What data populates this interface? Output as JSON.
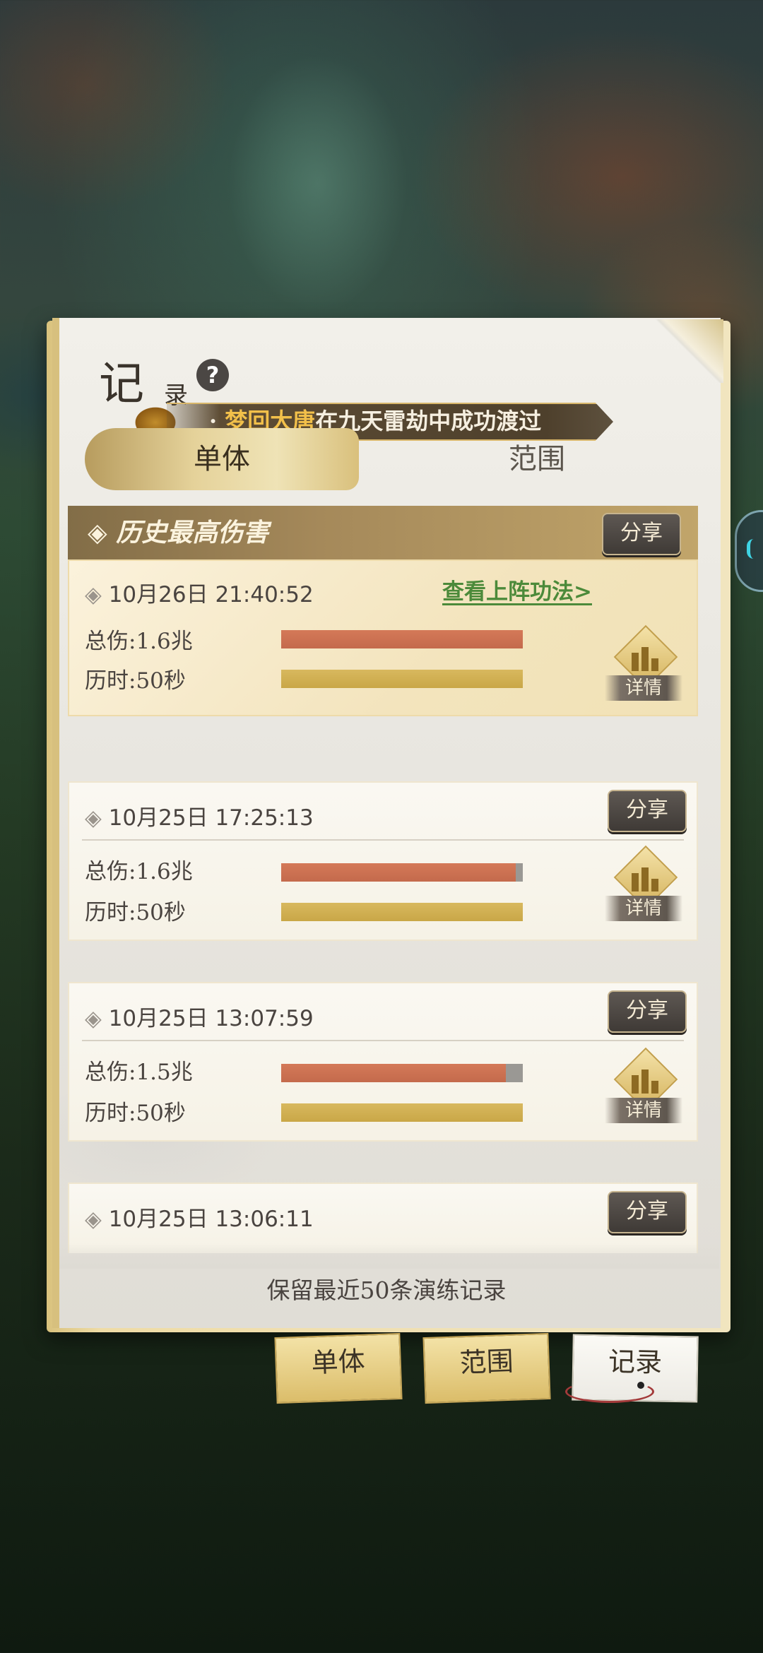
{
  "header": {
    "title_main": "记",
    "title_sub": "录",
    "help_label": "?",
    "ticker_who": "梦回大唐",
    "ticker_msg": "在九天雷劫中成功渡过",
    "ticker_prefix": "·"
  },
  "top_tabs": [
    {
      "label": "单体",
      "active": true
    },
    {
      "label": "范围",
      "active": false
    }
  ],
  "best": {
    "header_label": "历史最高伤害",
    "share_label": "分享",
    "time": "10月26日 21:40:52",
    "view_prev_link": "查看上阵功法>",
    "damage_label": "总伤:1.6兆",
    "duration_label": "历时:50秒",
    "damage_fill_pct": 100,
    "duration_fill_pct": 100,
    "detail_label": "详情"
  },
  "records": [
    {
      "time": "10月25日 17:25:13",
      "share_label": "分享",
      "damage_label": "总伤:1.6兆",
      "duration_label": "历时:50秒",
      "damage_fill_pct": 97,
      "duration_fill_pct": 100,
      "detail_label": "详情"
    },
    {
      "time": "10月25日 13:07:59",
      "share_label": "分享",
      "damage_label": "总伤:1.5兆",
      "duration_label": "历时:50秒",
      "damage_fill_pct": 93,
      "duration_fill_pct": 100,
      "detail_label": "详情"
    },
    {
      "time": "10月25日 13:06:11",
      "share_label": "分享"
    }
  ],
  "footer_note": "保留最近50条演练记录",
  "bottom_tabs": [
    {
      "label": "单体",
      "selected": false
    },
    {
      "label": "范围",
      "selected": false
    },
    {
      "label": "记录",
      "selected": true
    }
  ],
  "colors": {
    "damage_bar": "#c96f50",
    "duration_bar": "#cfae50",
    "link_green": "#4c8a3a",
    "ticker_highlight": "#f2c04a"
  },
  "icons": {
    "bullet": "diamond-bullet-icon",
    "detail": "bar-chart-icon",
    "help": "question-icon"
  }
}
